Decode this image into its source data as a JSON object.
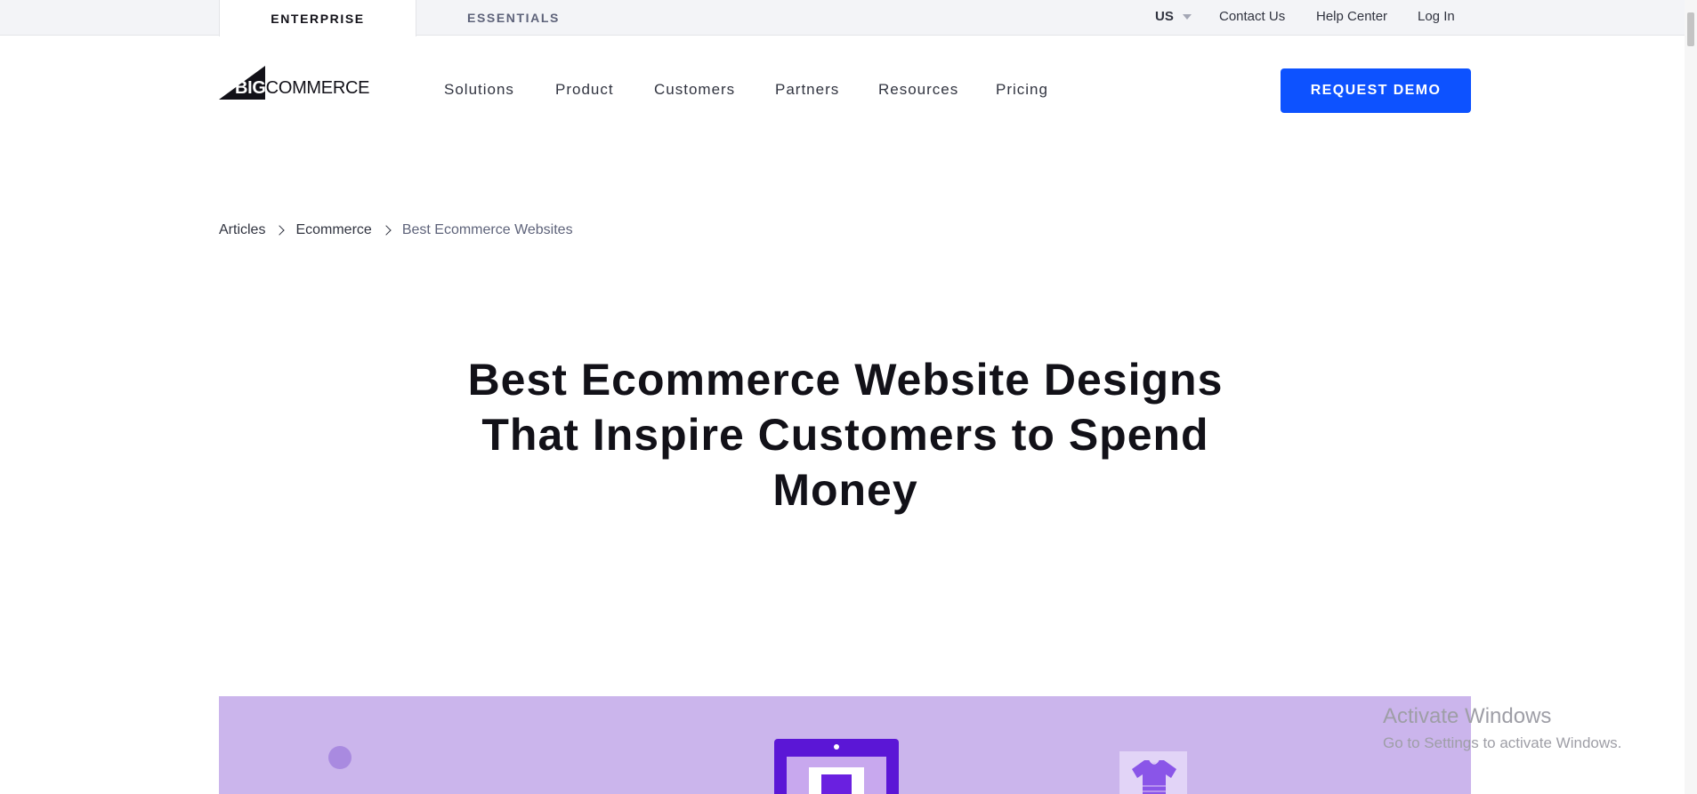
{
  "topbar": {
    "tabs": [
      {
        "label": "ENTERPRISE",
        "active": true
      },
      {
        "label": "ESSENTIALS",
        "active": false
      }
    ],
    "region": "US",
    "links": [
      "Contact Us",
      "Help Center",
      "Log In"
    ]
  },
  "logo": {
    "big": "BIG",
    "commerce": "COMMERCE"
  },
  "nav": {
    "items": [
      "Solutions",
      "Product",
      "Customers",
      "Partners",
      "Resources",
      "Pricing"
    ],
    "cta": "REQUEST DEMO"
  },
  "breadcrumb": {
    "items": [
      "Articles",
      "Ecommerce"
    ],
    "current": "Best Ecommerce Websites"
  },
  "headline": {
    "lines": [
      "Best Ecommerce Website Designs",
      "That Inspire Customers to Spend",
      "Money"
    ]
  },
  "watermark": {
    "title": "Activate Windows",
    "subtitle": "Go to Settings to activate Windows."
  },
  "colors": {
    "accent": "#0d52ff",
    "hero_bg": "#cbb5ec",
    "text": "#121118"
  }
}
